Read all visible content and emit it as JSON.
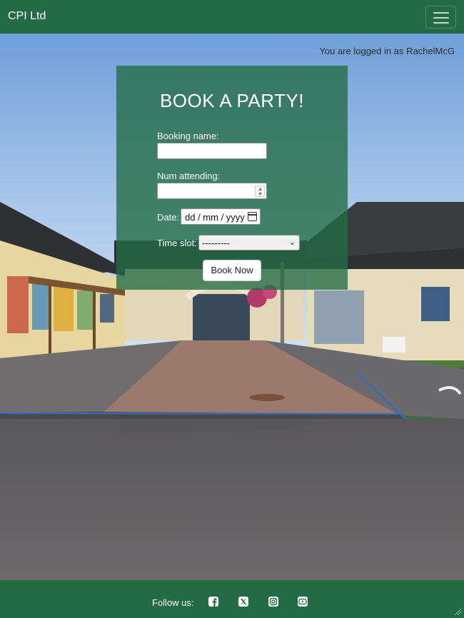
{
  "navbar": {
    "brand": "CPI Ltd",
    "menu_icon": "hamburger-menu-icon"
  },
  "user": {
    "login_status": "You are logged in as RachelMcG"
  },
  "booking_form": {
    "title": "BOOK A PARTY!",
    "booking_name_label": "Booking name:",
    "booking_name_value": "",
    "num_attending_label": "Num attending:",
    "num_attending_value": "",
    "date_label": "Date:",
    "date_placeholder": "dd / mm / yyyy",
    "time_slot_label": "Time slot:",
    "time_slot_value": "---------",
    "submit_label": "Book Now"
  },
  "footer": {
    "follow_label": "Follow us:",
    "social_icons": [
      "facebook-icon",
      "x-twitter-icon",
      "instagram-icon",
      "youtube-icon"
    ]
  },
  "colors": {
    "brand_green": "#236b44",
    "panel_green": "#236b44"
  }
}
